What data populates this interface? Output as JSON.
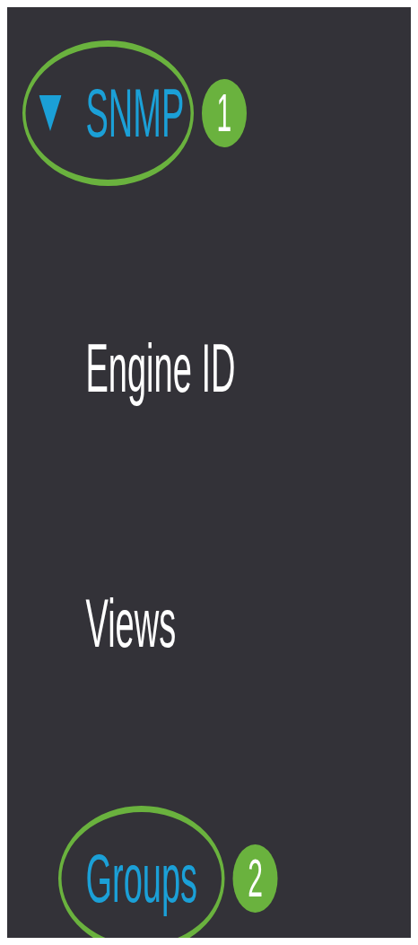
{
  "nav": {
    "header": {
      "label": "SNMP",
      "expanded": true,
      "selected": true,
      "highlighted": true,
      "callout": "1"
    },
    "items": [
      {
        "label": "Engine ID",
        "selected": false,
        "highlighted": false
      },
      {
        "label": "Views",
        "selected": false,
        "highlighted": false
      },
      {
        "label": "Groups",
        "selected": true,
        "highlighted": true,
        "callout": "2"
      }
    ]
  }
}
